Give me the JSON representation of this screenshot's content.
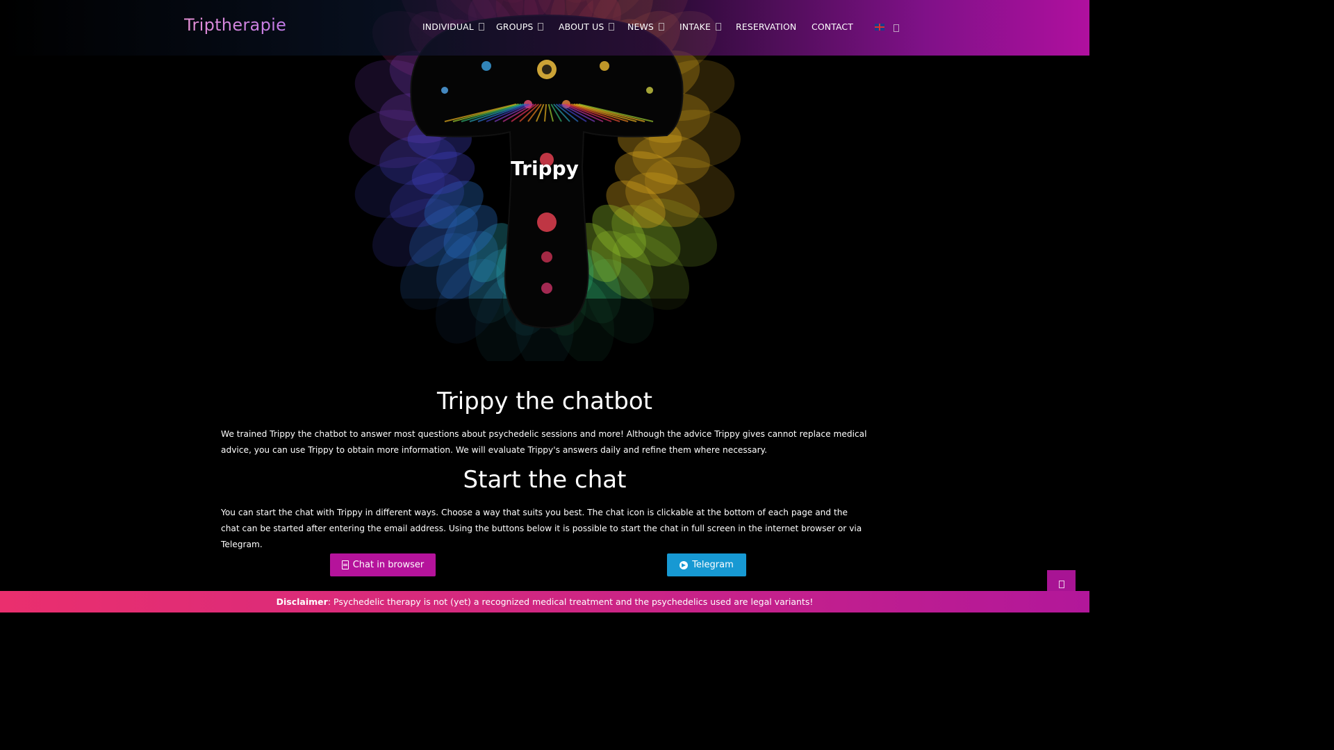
{
  "header": {
    "logo": "Triptherapie",
    "nav": [
      {
        "label": "INDIVIDUAL",
        "has_dropdown": true
      },
      {
        "label": "GROUPS",
        "has_dropdown": true
      },
      {
        "label": "ABOUT US",
        "has_dropdown": true
      },
      {
        "label": "NEWS",
        "has_dropdown": true
      },
      {
        "label": "INTAKE",
        "has_dropdown": true
      },
      {
        "label": "RESERVATION",
        "has_dropdown": false
      },
      {
        "label": "CONTACT",
        "has_dropdown": false
      }
    ],
    "language_icon": "uk-flag-icon",
    "language_dropdown_icon": "chevron-down-icon"
  },
  "hero": {
    "title": "Trippy",
    "image": "psychedelic-mushroom-illustration"
  },
  "main": {
    "heading1": "Trippy the chatbot",
    "paragraph1": "We trained Trippy the chatbot to answer most questions about psychedelic sessions and more! Although the advice Trippy gives cannot replace medical advice, you can use Trippy to obtain more information. We will evaluate Trippy's answers daily and refine them where necessary.",
    "heading2": "Start the chat",
    "paragraph2": "You can start the chat with Trippy in different ways. Choose a way that suits you best. The chat icon is clickable at the bottom of each page and the chat can be started after entering the email address. Using the buttons below it is possible to start the chat in full screen in the internet browser or via Telegram.",
    "buttons": {
      "browser": "Chat in browser",
      "telegram": "Telegram"
    }
  },
  "disclaimer": {
    "label": "Disclaimer",
    "text": ": Psychedelic therapy is not (yet) a recognized medical treatment and the psychedelics used are legal variants!"
  },
  "colors": {
    "brand_magenta": "#b5139b",
    "telegram_blue": "#1799d3",
    "disclaimer_pink": "#ea2f6e"
  }
}
